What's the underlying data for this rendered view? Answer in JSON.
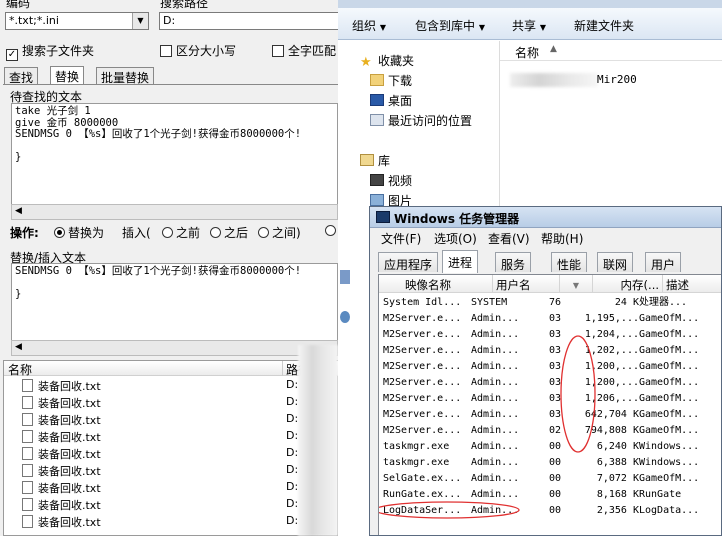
{
  "left_tool": {
    "labels": {
      "encoding": "编码",
      "search_path": "搜索路径"
    },
    "encoding_value": "*.txt;*.ini",
    "path_value": "D:",
    "options": {
      "subfolders": "搜索子文件夹",
      "case": "区分大小写",
      "fullwidth": "全字匹配"
    },
    "tabs": [
      "查找",
      "替换",
      "批量替换"
    ],
    "find_label": "待查找的文本",
    "find_text": "take 光子剑 1\ngive 金币 8000000\nSENDMSG 0 【%s】回收了1个光子剑!获得金币8000000个!\n\n}",
    "operation": {
      "label": "操作:",
      "replace": "替换为",
      "insert": "插入(",
      "before": "之前",
      "after": "之后",
      "between": "之间)"
    },
    "replace_label": "替换/插入文本",
    "replace_text": "SENDMSG 0 【%s】回收了1个光子剑!获得金币8000000个!\n\n}",
    "results_header": {
      "name": "名称",
      "path": "路径"
    },
    "results": [
      {
        "name": "装备回收.txt",
        "path": "D:"
      },
      {
        "name": "装备回收.txt",
        "path": "D:"
      },
      {
        "name": "装备回收.txt",
        "path": "D:"
      },
      {
        "name": "装备回收.txt",
        "path": "D:"
      },
      {
        "name": "装备回收.txt",
        "path": "D:"
      },
      {
        "name": "装备回收.txt",
        "path": "D:"
      },
      {
        "name": "装备回收.txt",
        "path": "D:"
      },
      {
        "name": "装备回收.txt",
        "path": "D:"
      },
      {
        "name": "装备回收.txt",
        "path": "D:"
      }
    ]
  },
  "explorer": {
    "toolbar": {
      "organize": "组织",
      "include": "包含到库中",
      "share": "共享",
      "new_folder": "新建文件夹"
    },
    "nav": {
      "favorites": "收藏夹",
      "downloads": "下载",
      "desktop": "桌面",
      "recent": "最近访问的位置",
      "libraries": "库",
      "videos": "视频",
      "pictures": "图片"
    },
    "column_name": "名称",
    "item_name": "Mir200"
  },
  "task_manager": {
    "title": "Windows 任务管理器",
    "menu": [
      "文件(F)",
      "选项(O)",
      "查看(V)",
      "帮助(H)"
    ],
    "tabs": [
      "应用程序",
      "进程",
      "服务",
      "性能",
      "联网",
      "用户"
    ],
    "columns": {
      "image": "映像名称",
      "user": "用户名",
      "cpu": "",
      "memory": "内存(...",
      "desc": "描述"
    },
    "processes": [
      {
        "image": "System Idl...",
        "user": "SYSTEM",
        "cpu": "76",
        "mem": "24 K",
        "desc": "处理器..."
      },
      {
        "image": "M2Server.e...",
        "user": "Admin...",
        "cpu": "03",
        "mem": "1,195,...",
        "desc": "GameOfM..."
      },
      {
        "image": "M2Server.e...",
        "user": "Admin...",
        "cpu": "03",
        "mem": "1,204,...",
        "desc": "GameOfM..."
      },
      {
        "image": "M2Server.e...",
        "user": "Admin...",
        "cpu": "03",
        "mem": "1,202,...",
        "desc": "GameOfM..."
      },
      {
        "image": "M2Server.e...",
        "user": "Admin...",
        "cpu": "03",
        "mem": "1,200,...",
        "desc": "GameOfM..."
      },
      {
        "image": "M2Server.e...",
        "user": "Admin...",
        "cpu": "03",
        "mem": "1,200,...",
        "desc": "GameOfM..."
      },
      {
        "image": "M2Server.e...",
        "user": "Admin...",
        "cpu": "03",
        "mem": "1,206,...",
        "desc": "GameOfM..."
      },
      {
        "image": "M2Server.e...",
        "user": "Admin...",
        "cpu": "03",
        "mem": "642,704 K",
        "desc": "GameOfM..."
      },
      {
        "image": "M2Server.e...",
        "user": "Admin...",
        "cpu": "02",
        "mem": "794,808 K",
        "desc": "GameOfM..."
      },
      {
        "image": "taskmgr.exe",
        "user": "Admin...",
        "cpu": "00",
        "mem": "6,240 K",
        "desc": "Windows..."
      },
      {
        "image": "taskmgr.exe",
        "user": "Admin...",
        "cpu": "00",
        "mem": "6,388 K",
        "desc": "Windows..."
      },
      {
        "image": "SelGate.ex...",
        "user": "Admin...",
        "cpu": "00",
        "mem": "7,072 K",
        "desc": "GameOfM..."
      },
      {
        "image": "RunGate.ex...",
        "user": "Admin...",
        "cpu": "00",
        "mem": "8,168 K",
        "desc": "RunGate"
      },
      {
        "image": "LogDataSer...",
        "user": "Admin...",
        "cpu": "00",
        "mem": "2,356 K",
        "desc": "LogData..."
      }
    ],
    "annotation_color": "#e03030"
  }
}
